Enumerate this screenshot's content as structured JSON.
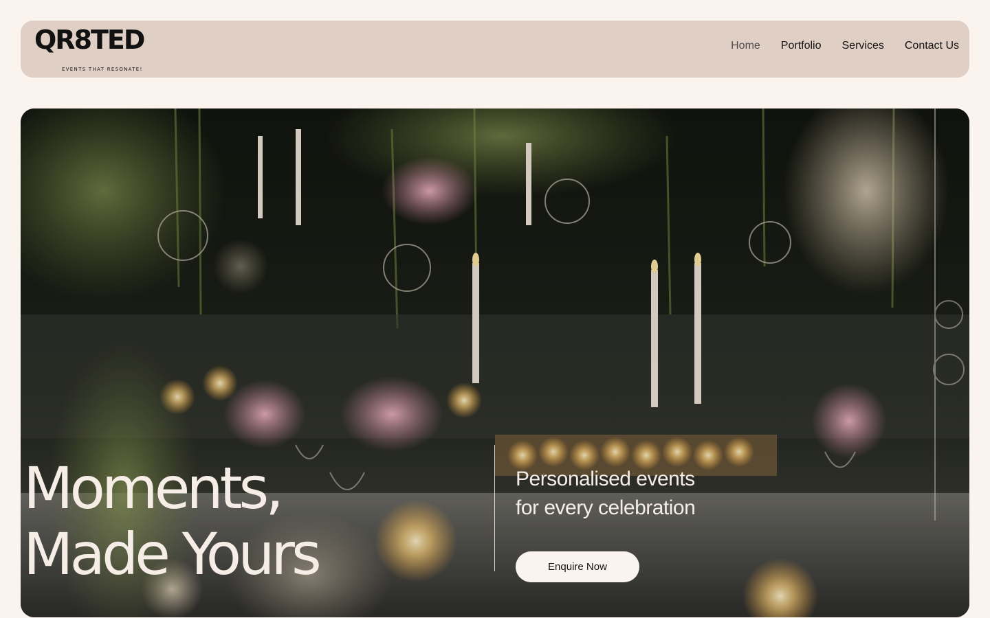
{
  "brand": {
    "wordmark": "QR8TED",
    "tagline": "EVENTS THAT RESONATE!"
  },
  "nav": {
    "items": [
      {
        "label": "Home",
        "active": true
      },
      {
        "label": "Portfolio",
        "active": false
      },
      {
        "label": "Services",
        "active": false
      },
      {
        "label": "Contact Us",
        "active": false
      }
    ]
  },
  "hero": {
    "title_line1": "Moments,",
    "title_line2": "Made Yours",
    "subtitle_line1": "Personalised events",
    "subtitle_line2": "for every celebration",
    "cta_label": "Enquire Now"
  },
  "colors": {
    "page_bg": "#fbf4ee",
    "header_bg": "#dfcfc4",
    "hero_text": "#f6ede6"
  }
}
